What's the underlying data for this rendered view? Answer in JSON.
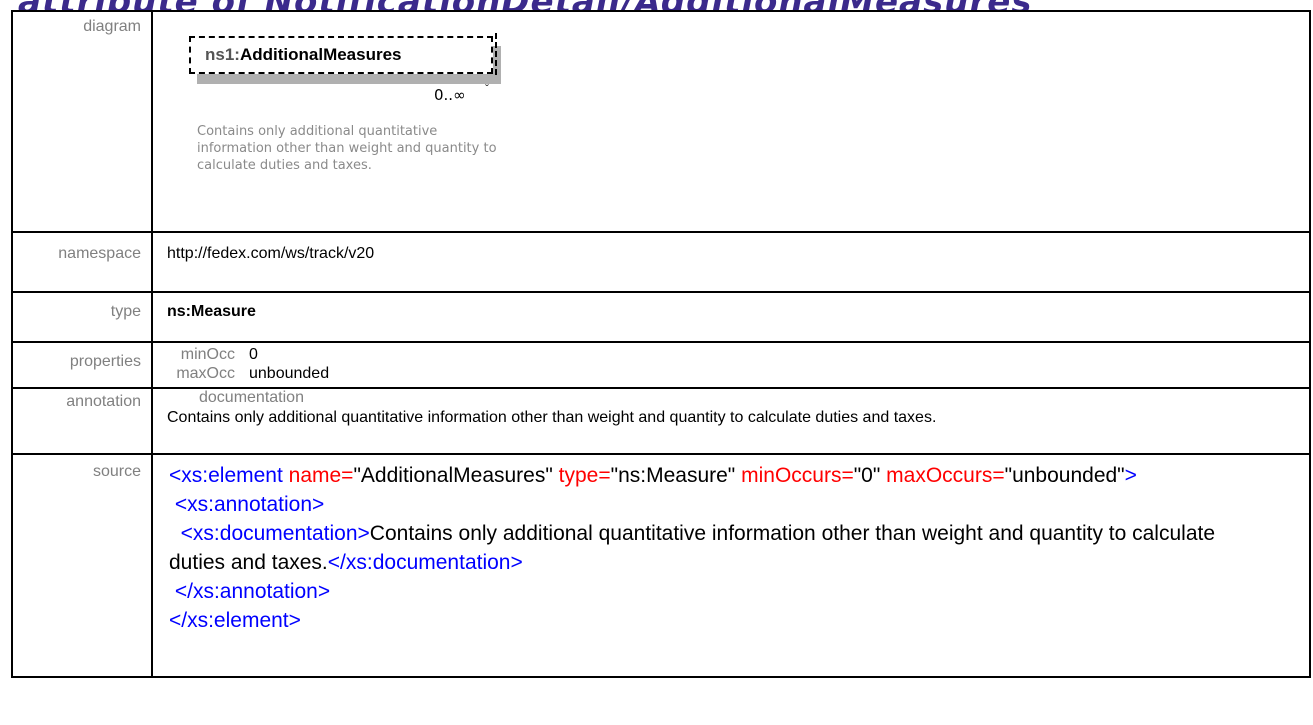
{
  "banner": "attribute of NotificationDetail/AdditionalMeasures",
  "labels": {
    "diagram": "diagram",
    "namespace": "namespace",
    "type": "type",
    "properties": "properties",
    "annotation": "annotation",
    "source": "source"
  },
  "diagram": {
    "prefix": "ns1:",
    "name": "AdditionalMeasures",
    "cardinality": "0..∞",
    "note": "Contains only additional quantitative information other than weight and quantity to calculate duties and taxes."
  },
  "namespace": "http://fedex.com/ws/track/v20",
  "type": "ns:Measure",
  "properties": [
    {
      "key": "minOcc",
      "value": "0"
    },
    {
      "key": "maxOcc",
      "value": "unbounded"
    }
  ],
  "annotation": {
    "heading": "documentation",
    "text": "Contains only additional quantitative information other than weight and quantity to calculate duties and taxes."
  },
  "source": {
    "open_tag": "<xs:element",
    "attr1_name": "name=",
    "attr1_value": "\"AdditionalMeasures\"",
    "attr2_name": "type=",
    "attr2_value": "\"ns:Measure\"",
    "attr3_name": "minOccurs=",
    "attr3_value": "\"0\"",
    "attr4_name": "maxOccurs=",
    "attr4_value": "\"unbounded\"",
    "gt": "\">",
    "ann_open": "<xs:annotation>",
    "doc_open": "<xs:documentation>",
    "doc_text": "Contains only additional quantitative information other than weight and quantity to calculate duties and taxes.",
    "doc_close": "</xs:documentation>",
    "ann_close": "</xs:annotation>",
    "el_close": "</xs:element>"
  },
  "colors": {
    "tag": "#0000ff",
    "element_name": "#800000",
    "attr_name": "#ff0000",
    "label_gray": "#808080"
  }
}
